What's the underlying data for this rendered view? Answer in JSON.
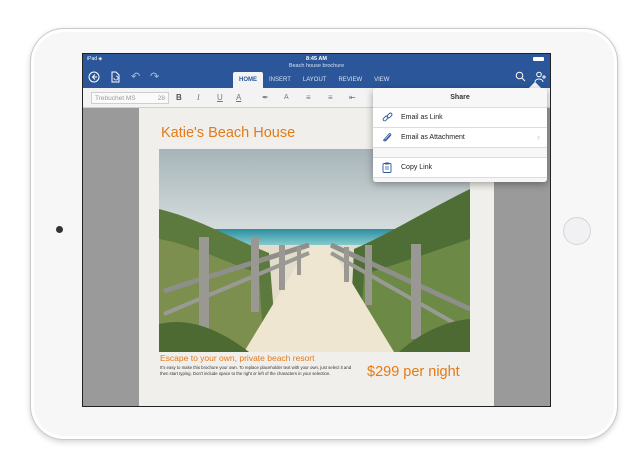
{
  "status": {
    "device": "iPad",
    "time": "8:45 AM"
  },
  "document": {
    "name": "Beach house brochure",
    "title": "Katie's Beach House",
    "tagline": "Escape to your own, private beach resort",
    "body": "It's easy to make this brochure your own. To replace placeholder text with your own, just select it and then start typing. Don't include space to the right or left of the characters in your selection.",
    "price": "$299 per night"
  },
  "ribbon": {
    "tabs": [
      "HOME",
      "INSERT",
      "LAYOUT",
      "REVIEW",
      "VIEW"
    ],
    "active_tab": "HOME",
    "font_name": "Trebuchet MS",
    "font_size": "28",
    "bold": "B",
    "italic": "I",
    "underline": "U",
    "text_effects": "A",
    "font_color": "A"
  },
  "share_menu": {
    "title": "Share",
    "items": [
      {
        "label": "Email as Link",
        "icon": "link-icon"
      },
      {
        "label": "Email as Attachment",
        "icon": "paperclip-icon"
      },
      {
        "label": "Copy Link",
        "icon": "clipboard-icon"
      }
    ]
  },
  "colors": {
    "ribbon_blue": "#2b579a",
    "accent_orange": "#e37a18"
  }
}
